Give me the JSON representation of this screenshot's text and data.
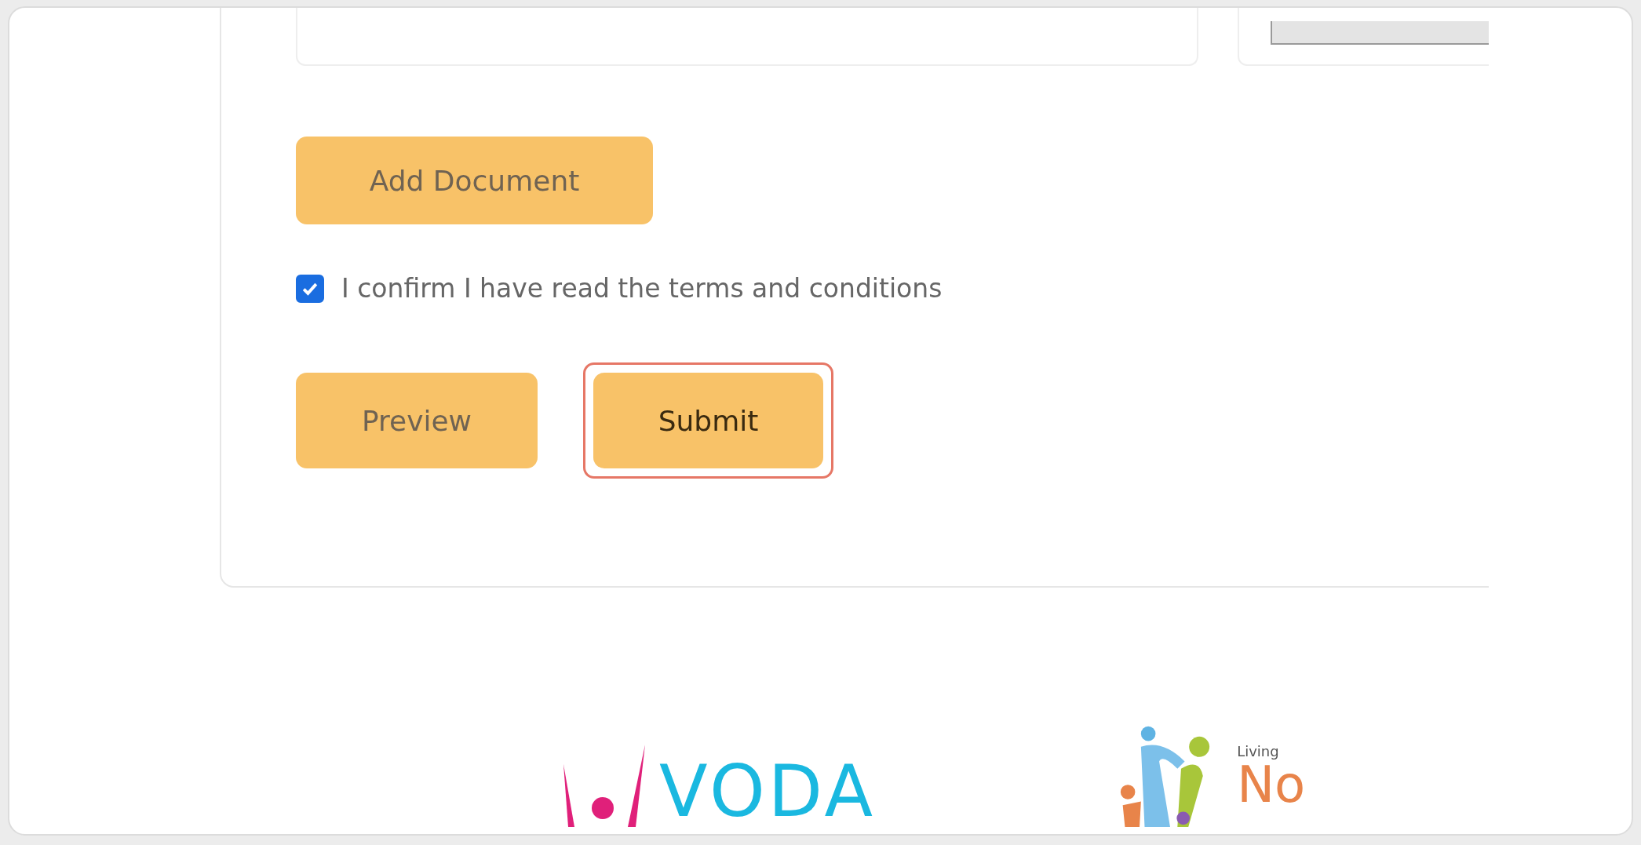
{
  "add_button": {
    "label": "Add Document"
  },
  "terms": {
    "label": "I confirm I have read the terms and conditions",
    "checked": true
  },
  "actions": [
    {
      "label": "Preview",
      "focused": false
    },
    {
      "label": "Submit",
      "focused": true
    }
  ],
  "footer_logos": [
    {
      "kind": "voda",
      "text": "VODA"
    },
    {
      "kind": "living",
      "tagline": "Living",
      "name": "No"
    }
  ]
}
